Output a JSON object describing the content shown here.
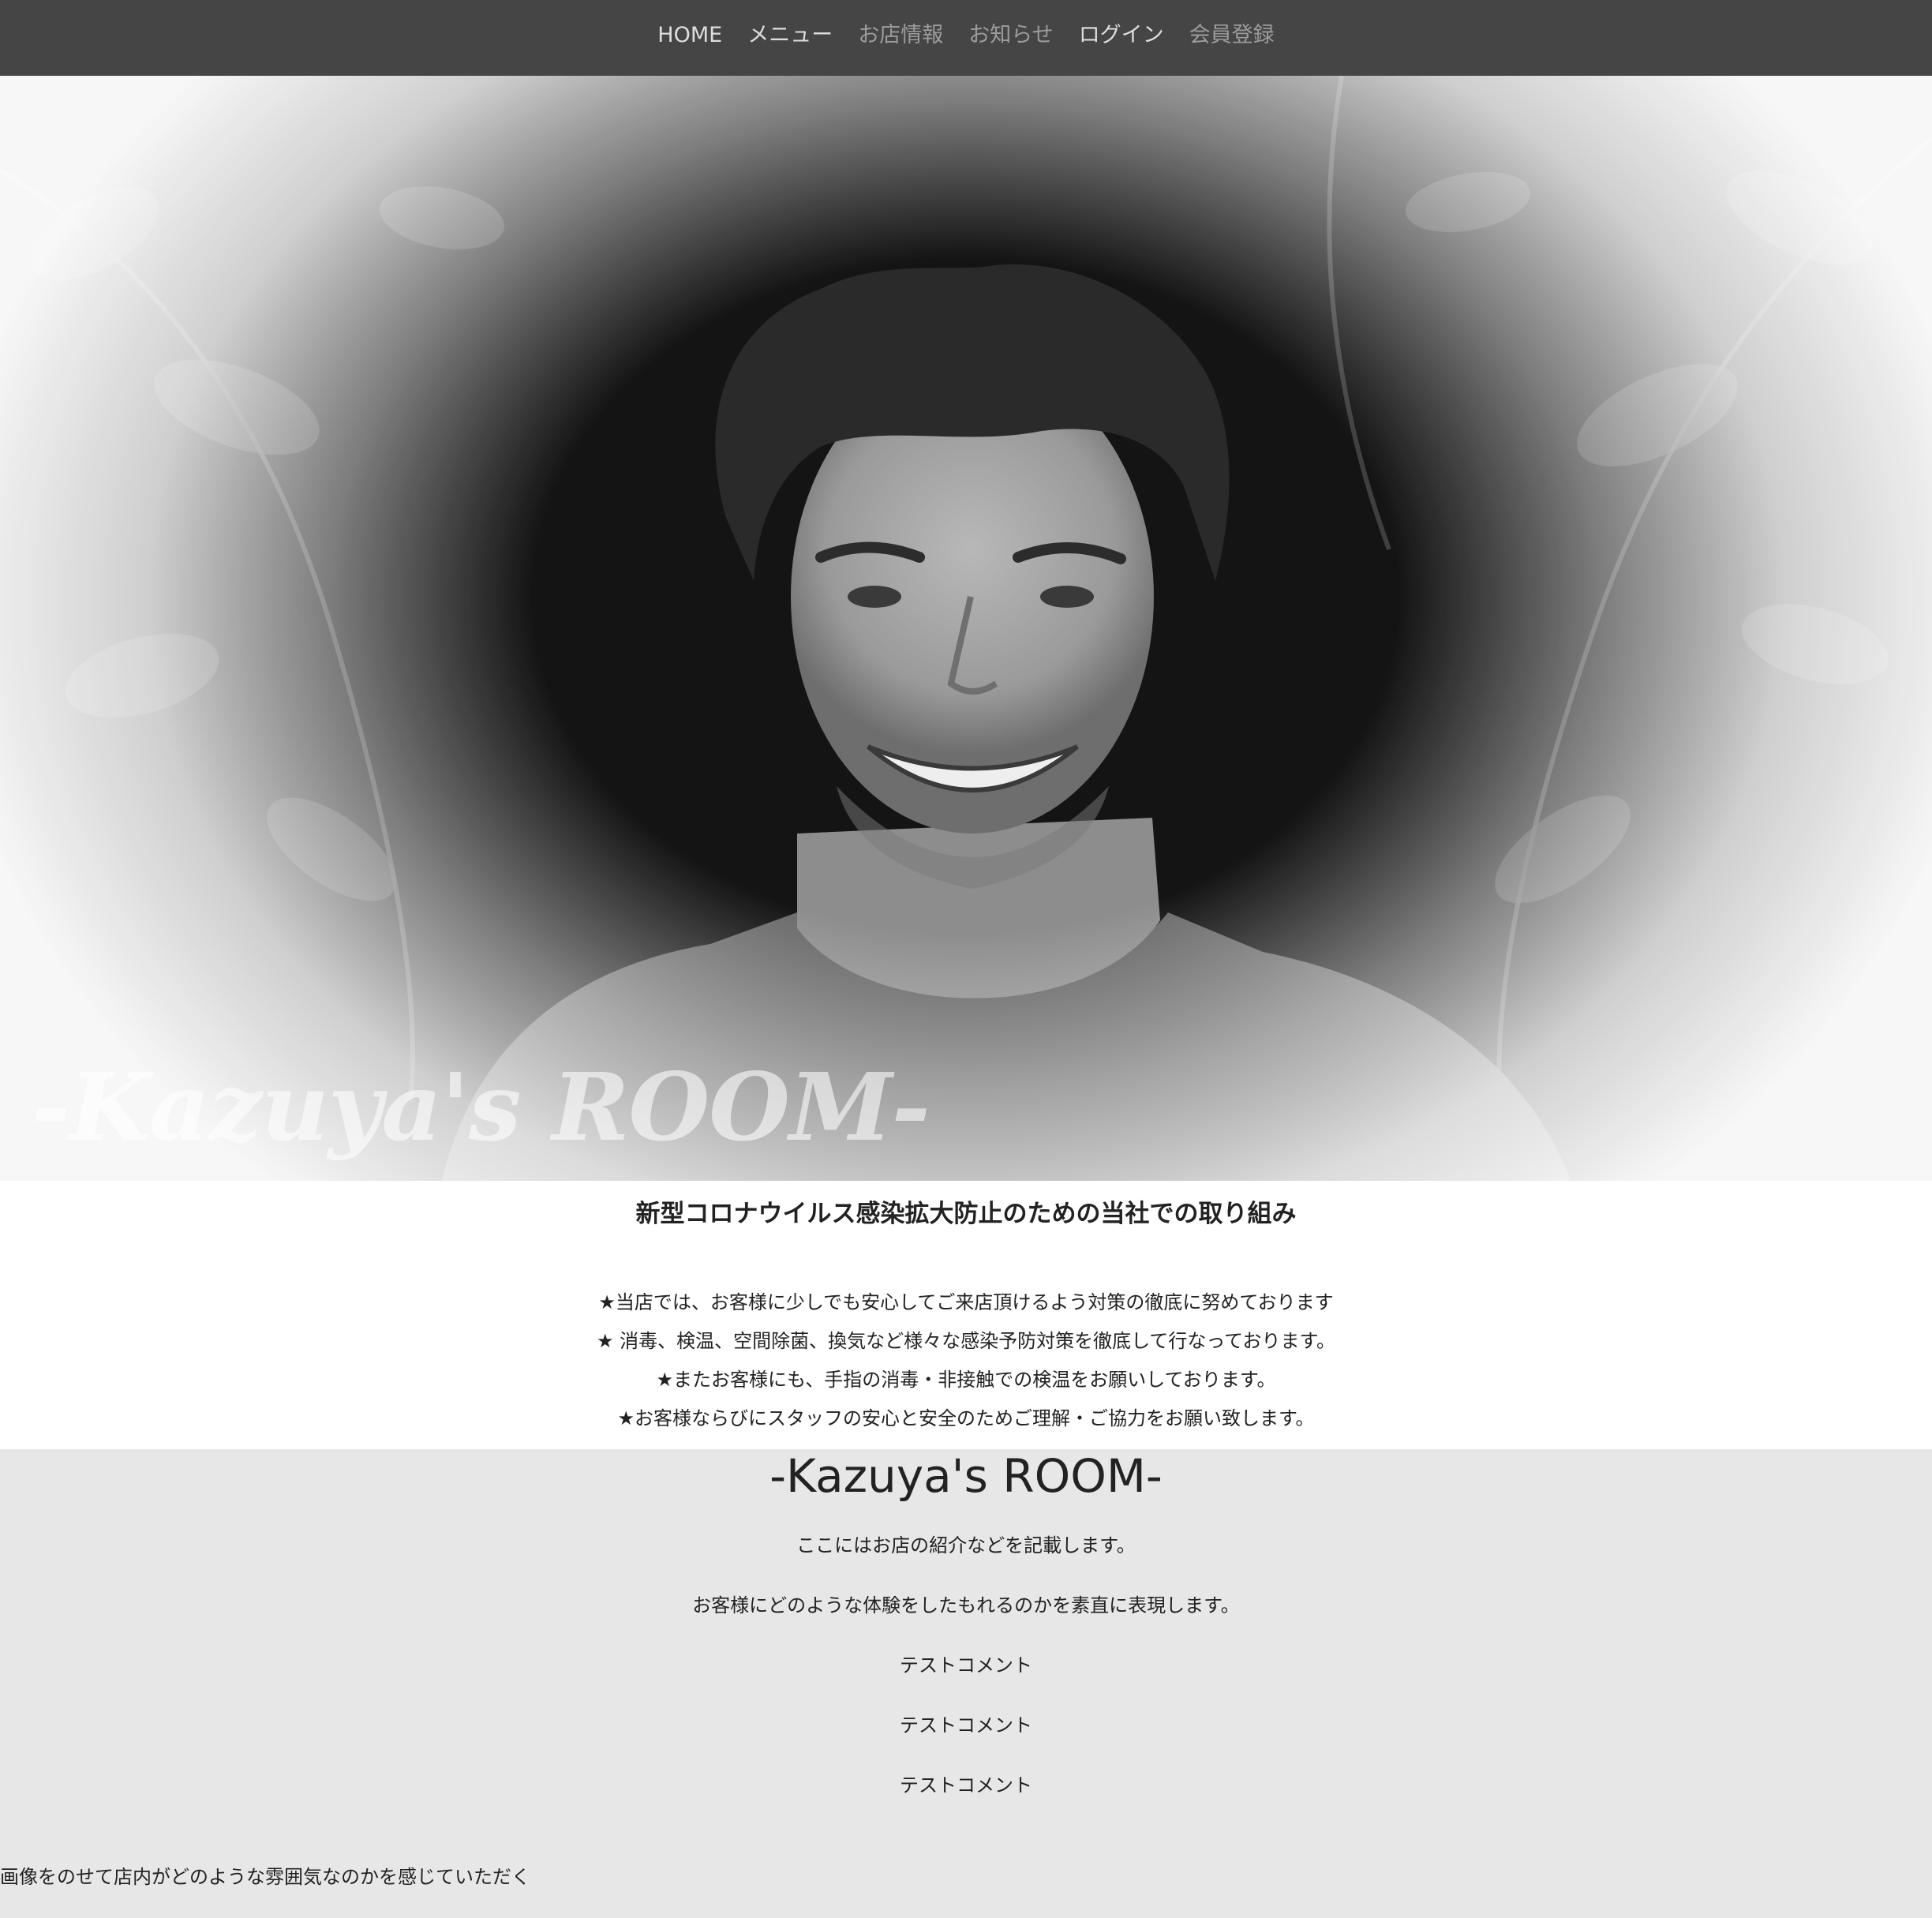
{
  "nav": {
    "items": [
      {
        "label": "HOME"
      },
      {
        "label": "メニュー"
      },
      {
        "label": "お店情報"
      },
      {
        "label": "お知らせ"
      },
      {
        "label": "ログイン"
      },
      {
        "label": "会員登録"
      }
    ]
  },
  "hero": {
    "logo_text": "-Kazuya's ROOM-"
  },
  "notice": {
    "title": "新型コロナウイルス感染拡大防止のための当社での取り組み",
    "lines": [
      "★当店では、お客様に少しでも安心してご来店頂けるよう対策の徹底に努めております",
      "★ 消毒、検温、空間除菌、換気など様々な感染予防対策を徹底して行なっております。",
      "★またお客様にも、手指の消毒・非接触での検温をお願いしております。",
      "★お客様ならびにスタッフの安心と安全のためご理解・ご協力をお願い致します。"
    ]
  },
  "about": {
    "title": "-Kazuya's ROOM-",
    "paragraphs": [
      "ここにはお店の紹介などを記載します。",
      "お客様にどのような体験をしたもれるのかを素直に表現します。",
      "テストコメント",
      "テストコメント",
      "テストコメント"
    ],
    "caption": "画像をのせて店内がどのような雰囲気なのかを感じていただく"
  },
  "colors": {
    "nav_background": "#454545",
    "about_background": "#e8e7e8",
    "text": "#222222"
  }
}
